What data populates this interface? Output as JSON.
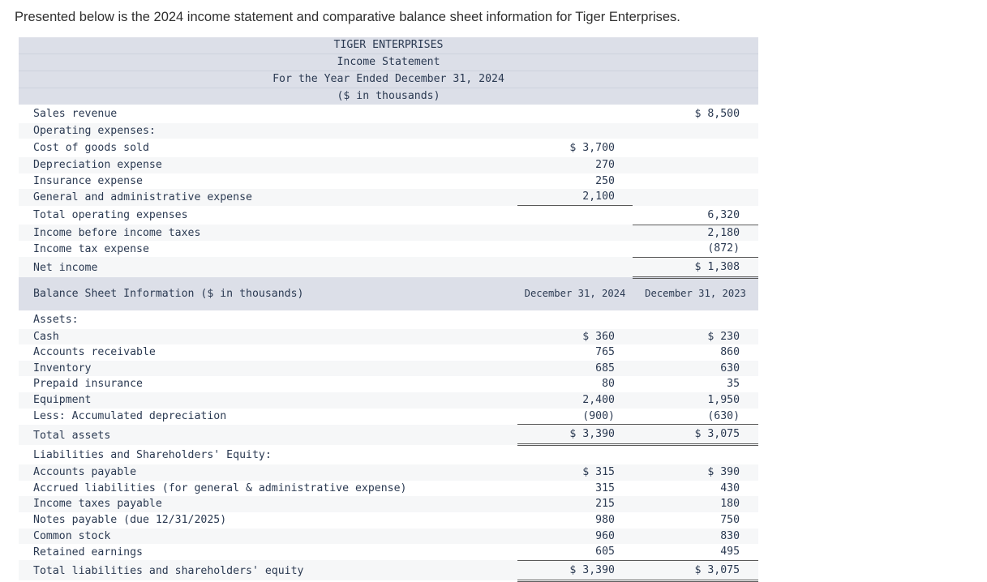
{
  "intro": "Presented below is the 2024 income statement and comparative balance sheet information for Tiger Enterprises.",
  "income_statement": {
    "title_lines": [
      "TIGER ENTERPRISES",
      "Income Statement",
      "For the Year Ended December 31, 2024",
      "($ in thousands)"
    ],
    "rows": [
      {
        "label": "Sales revenue",
        "inner": "",
        "outer": "$ 8,500"
      },
      {
        "label": "Operating expenses:",
        "inner": "",
        "outer": ""
      },
      {
        "label": "Cost of goods sold",
        "inner": "$ 3,700",
        "outer": ""
      },
      {
        "label": "Depreciation expense",
        "inner": "270",
        "outer": ""
      },
      {
        "label": "Insurance expense",
        "inner": "250",
        "outer": ""
      },
      {
        "label": "General and administrative expense",
        "inner": "2,100",
        "outer": ""
      },
      {
        "label": "Total operating expenses",
        "inner": "",
        "outer": "6,320"
      },
      {
        "label": "Income before income taxes",
        "inner": "",
        "outer": "2,180"
      },
      {
        "label": "Income tax expense",
        "inner": "",
        "outer": "(872)"
      },
      {
        "label": "Net income",
        "inner": "",
        "outer": "$ 1,308"
      }
    ]
  },
  "balance_sheet": {
    "section_title": "Balance Sheet Information ($ in thousands)",
    "col_2024": "December 31, 2024",
    "col_2023": "December 31, 2023",
    "assets_heading": "Assets:",
    "assets": [
      {
        "label": "Cash",
        "y2024": "$ 360",
        "y2023": "$ 230"
      },
      {
        "label": "Accounts receivable",
        "y2024": "765",
        "y2023": "860"
      },
      {
        "label": "Inventory",
        "y2024": "685",
        "y2023": "630"
      },
      {
        "label": "Prepaid insurance",
        "y2024": "80",
        "y2023": "35"
      },
      {
        "label": "Equipment",
        "y2024": "2,400",
        "y2023": "1,950"
      },
      {
        "label": "Less: Accumulated depreciation",
        "y2024": "(900)",
        "y2023": "(630)"
      }
    ],
    "total_assets": {
      "label": "Total assets",
      "y2024": "$ 3,390",
      "y2023": "$ 3,075"
    },
    "liabilities_heading": "Liabilities and Shareholders' Equity:",
    "liabilities": [
      {
        "label": "Accounts payable",
        "y2024": "$ 315",
        "y2023": "$ 390"
      },
      {
        "label": "Accrued liabilities (for general & administrative expense)",
        "y2024": "315",
        "y2023": "430"
      },
      {
        "label": "Income taxes payable",
        "y2024": "215",
        "y2023": "180"
      },
      {
        "label": "Notes payable (due 12/31/2025)",
        "y2024": "980",
        "y2023": "750"
      },
      {
        "label": "Common stock",
        "y2024": "960",
        "y2023": "830"
      },
      {
        "label": "Retained earnings",
        "y2024": "605",
        "y2023": "495"
      }
    ],
    "total_liab_equity": {
      "label": "Total liabilities and shareholders' equity",
      "y2024": "$ 3,390",
      "y2023": "$ 3,075"
    }
  }
}
